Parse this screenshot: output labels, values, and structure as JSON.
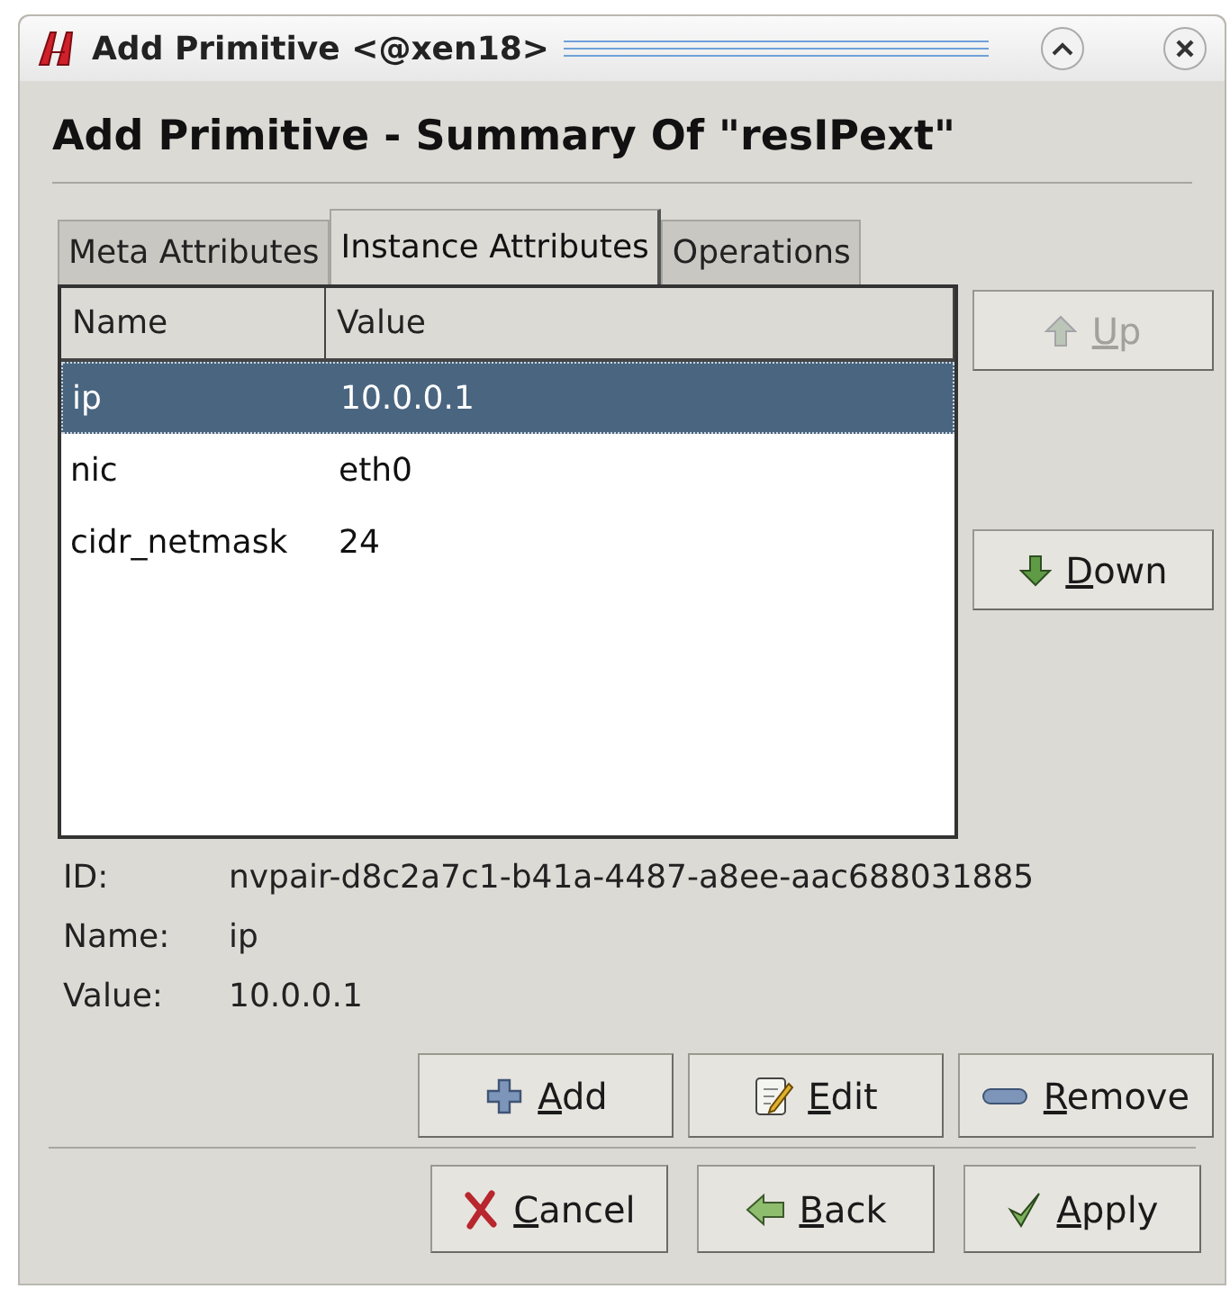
{
  "window": {
    "title": "Add Primitive <@xen18>"
  },
  "heading": "Add Primitive - Summary Of \"resIPext\"",
  "tabs": [
    {
      "label": "Meta Attributes",
      "selected": false
    },
    {
      "label": "Instance Attributes",
      "selected": true
    },
    {
      "label": "Operations",
      "selected": false
    }
  ],
  "table": {
    "columns": [
      "Name",
      "Value"
    ],
    "rows": [
      {
        "name": "ip",
        "value": "10.0.0.1",
        "selected": true
      },
      {
        "name": "nic",
        "value": "eth0",
        "selected": false
      },
      {
        "name": "cidr_netmask",
        "value": "24",
        "selected": false
      }
    ]
  },
  "side_buttons": [
    {
      "kind": "up",
      "accel": "U",
      "rest": "p",
      "disabled": true
    },
    {
      "kind": "down",
      "accel": "D",
      "rest": "own",
      "disabled": false
    }
  ],
  "details": [
    {
      "label": "ID:",
      "value": "nvpair-d8c2a7c1-b41a-4487-a8ee-aac688031885"
    },
    {
      "label": "Name:",
      "value": "ip"
    },
    {
      "label": "Value:",
      "value": "10.0.0.1"
    }
  ],
  "item_buttons": [
    {
      "kind": "add",
      "accel": "A",
      "rest": "dd"
    },
    {
      "kind": "edit",
      "accel": "E",
      "rest": "dit"
    },
    {
      "kind": "remove",
      "accel": "R",
      "rest": "emove"
    }
  ],
  "dialog_buttons": [
    {
      "kind": "cancel",
      "accel": "C",
      "rest": "ancel"
    },
    {
      "kind": "back",
      "accel": "B",
      "rest": "ack"
    },
    {
      "kind": "apply",
      "accel": "A",
      "rest": "pply"
    }
  ]
}
